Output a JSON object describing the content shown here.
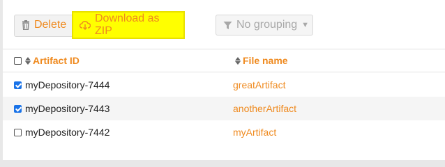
{
  "toolbar": {
    "delete_label": "Delete",
    "download_label": "Download as ZIP",
    "grouping_label": "No grouping",
    "accent_color": "#ef8a1f",
    "highlight_color": "#ffff00"
  },
  "table": {
    "columns": [
      "Artifact ID",
      "File name"
    ],
    "rows": [
      {
        "artifact_id": "myDepository-7444",
        "file_name": "greatArtifact",
        "checked": true
      },
      {
        "artifact_id": "myDepository-7443",
        "file_name": "anotherArtifact",
        "checked": true
      },
      {
        "artifact_id": "myDepository-7442",
        "file_name": "myArtifact",
        "checked": false
      }
    ]
  },
  "icons": {
    "delete": "trash-icon",
    "download": "cloud-download-icon",
    "grouping": "filter-icon",
    "sort": "sort-icon"
  }
}
